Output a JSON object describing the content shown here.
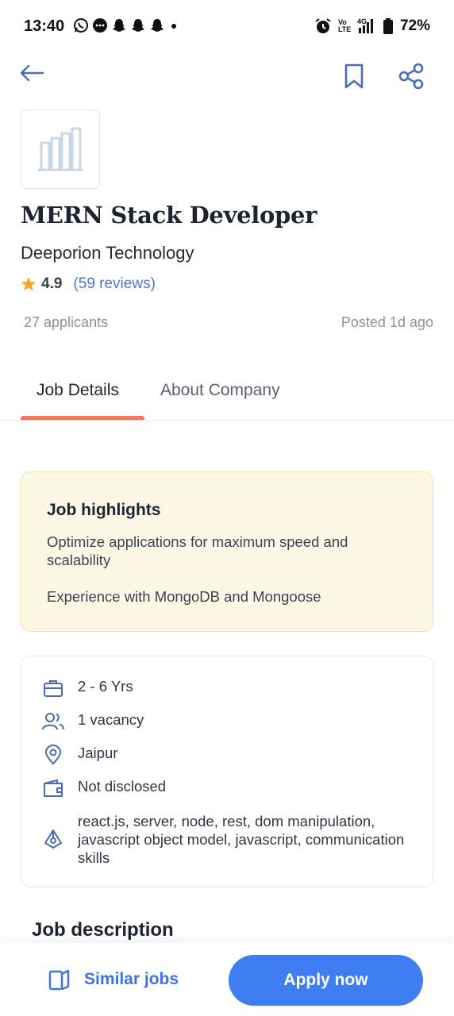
{
  "status_bar": {
    "time": "13:40",
    "battery": "72%",
    "network": "4G",
    "volte": "Vo LTE",
    "left_icons": [
      "whatsapp-icon",
      "message-icon",
      "snapchat-icon",
      "snapchat-icon",
      "snapchat-icon",
      "dot-icon"
    ],
    "right_icons": [
      "alarm-icon",
      "volte-icon",
      "signal-icon",
      "battery-icon"
    ]
  },
  "app_bar": {
    "back_icon": "arrow-left-icon",
    "bookmark_icon": "bookmark-icon",
    "share_icon": "share-icon"
  },
  "job": {
    "title": "MERN Stack Developer",
    "company": "Deeporion Technology",
    "rating": "4.9",
    "reviews": "(59 reviews)",
    "applicants": "27 applicants",
    "posted": "Posted 1d ago"
  },
  "tabs": {
    "job_details": "Job Details",
    "about_company": "About Company",
    "active": "Job Details"
  },
  "highlights": {
    "title": "Job highlights",
    "items": [
      "Optimize applications for maximum speed and scalability",
      "Experience with MongoDB and Mongoose"
    ]
  },
  "details": {
    "experience": "2 - 6 Yrs",
    "vacancy": "1 vacancy",
    "location": "Jaipur",
    "salary": "Not disclosed",
    "skills": "react.js, server, node, rest, dom manipulation, javascript object model, javascript, communication skills"
  },
  "description": {
    "title": "Job description"
  },
  "bottom_bar": {
    "similar_jobs": "Similar jobs",
    "apply_now": "Apply now"
  },
  "colors": {
    "accent": "#3f7df2",
    "tab_indicator": "#f07a5e",
    "highlight_bg": "#fdf8e6",
    "rating_star": "#f5a623",
    "link": "#4a77d9"
  }
}
